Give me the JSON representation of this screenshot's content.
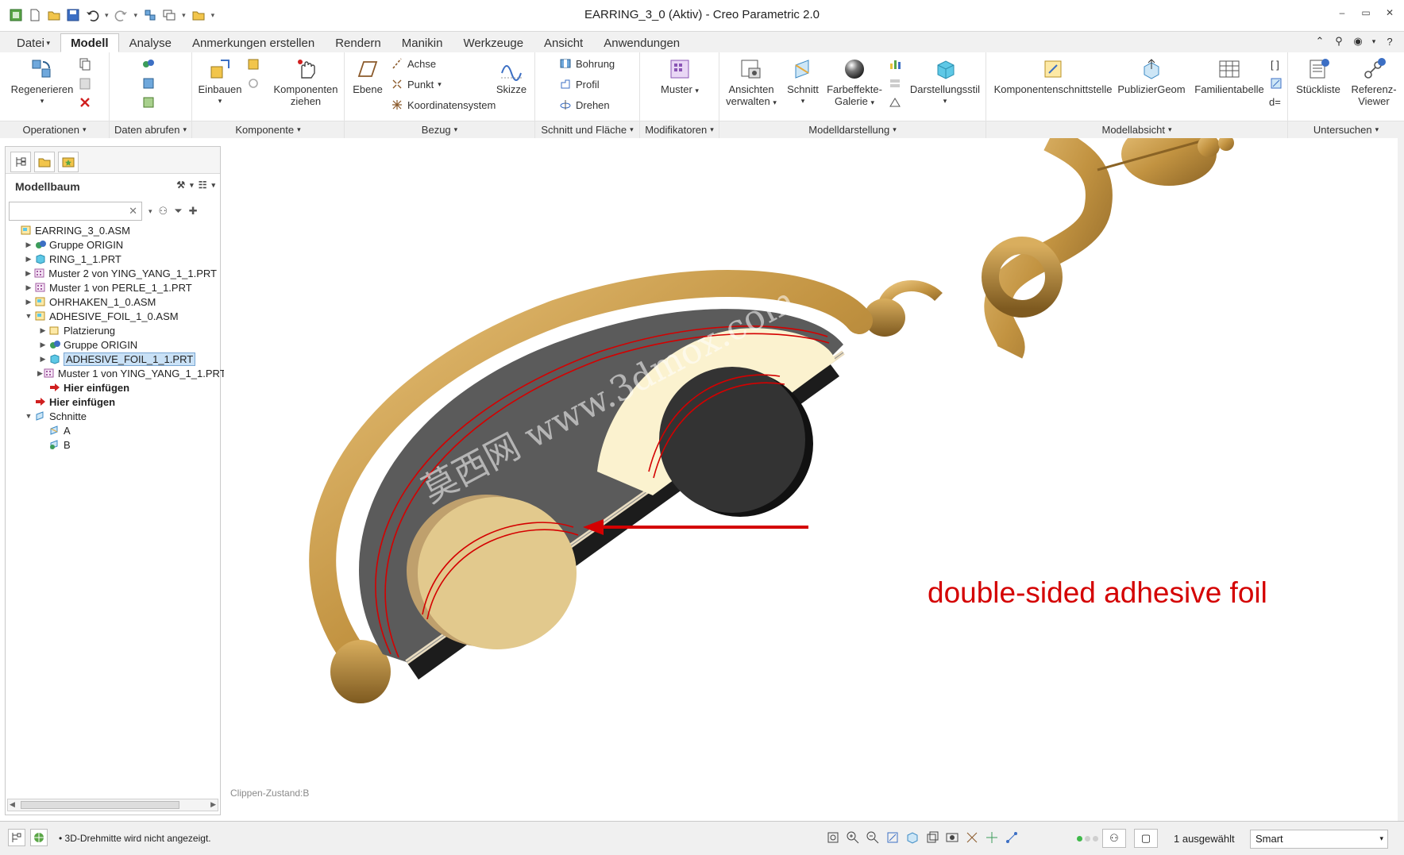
{
  "window": {
    "title": "EARRING_3_0 (Aktiv) - Creo Parametric 2.0"
  },
  "ribbon_tabs": [
    {
      "label": "Datei",
      "dropdown": "▾"
    },
    {
      "label": "Modell",
      "active": true
    },
    {
      "label": "Analyse"
    },
    {
      "label": "Anmerkungen erstellen"
    },
    {
      "label": "Rendern"
    },
    {
      "label": "Manikin"
    },
    {
      "label": "Werkzeuge"
    },
    {
      "label": "Ansicht"
    },
    {
      "label": "Anwendungen"
    }
  ],
  "ribbon": {
    "operationen": {
      "footer": "Operationen",
      "regenerieren": "Regenerieren"
    },
    "daten_abrufen": {
      "footer": "Daten abrufen"
    },
    "komponente": {
      "footer": "Komponente",
      "einbauen": "Einbauen",
      "komponenten_ziehen_1": "Komponenten",
      "komponenten_ziehen_2": "ziehen"
    },
    "bezug": {
      "footer": "Bezug",
      "ebene": "Ebene",
      "achse": "Achse",
      "punkt": "Punkt",
      "koordinatensystem": "Koordinatensystem",
      "skizze": "Skizze"
    },
    "schnitt_flaeche": {
      "footer": "Schnitt und Fläche",
      "bohrung": "Bohrung",
      "profil": "Profil",
      "drehen": "Drehen"
    },
    "modifikatoren": {
      "footer": "Modifikatoren",
      "muster": "Muster"
    },
    "modelldarstellung": {
      "footer": "Modelldarstellung",
      "ansichten_1": "Ansichten",
      "ansichten_2": "verwalten",
      "schnitt": "Schnitt",
      "farbeffekte_1": "Farbeffekte-",
      "farbeffekte_2": "Galerie",
      "darstellungsstil": "Darstellungsstil"
    },
    "modellabsicht": {
      "footer": "Modellabsicht",
      "komponentenschnittstelle": "Komponentenschnittstelle",
      "publiziergeom": "PublizierGeom",
      "familientabelle": "Familientabelle",
      "d_eq": "d="
    },
    "untersuchen": {
      "footer": "Untersuchen",
      "stueckliste": "Stückliste",
      "referenz_1": "Referenz-",
      "referenz_2": "Viewer"
    }
  },
  "left_panel": {
    "header": "Modellbaum",
    "search_value": "",
    "tree": [
      {
        "label": "EARRING_3_0.ASM",
        "level": 0,
        "toggle": "",
        "icon": "assembly"
      },
      {
        "label": "Gruppe ORIGIN",
        "level": 1,
        "toggle": "▶",
        "icon": "group"
      },
      {
        "label": "RING_1_1.PRT",
        "level": 1,
        "toggle": "▶",
        "icon": "part"
      },
      {
        "label": "Muster 2 von YING_YANG_1_1.PRT",
        "level": 1,
        "toggle": "▶",
        "icon": "pattern"
      },
      {
        "label": "Muster 1 von PERLE_1_1.PRT",
        "level": 1,
        "toggle": "▶",
        "icon": "pattern"
      },
      {
        "label": "OHRHAKEN_1_0.ASM",
        "level": 1,
        "toggle": "▶",
        "icon": "assembly"
      },
      {
        "label": "ADHESIVE_FOIL_1_0.ASM",
        "level": 1,
        "toggle": "▼",
        "icon": "assembly"
      },
      {
        "label": "Platzierung",
        "level": 2,
        "toggle": "▶",
        "icon": "placement"
      },
      {
        "label": "Gruppe ORIGIN",
        "level": 2,
        "toggle": "▶",
        "icon": "group"
      },
      {
        "label": "ADHESIVE_FOIL_1_1.PRT",
        "level": 2,
        "toggle": "▶",
        "icon": "part",
        "selected": true
      },
      {
        "label": "Muster 1 von YING_YANG_1_1.PRT",
        "level": 2,
        "toggle": "▶",
        "icon": "pattern"
      },
      {
        "label": "Hier einfügen",
        "level": 2,
        "toggle": "",
        "icon": "insert",
        "bold": true
      },
      {
        "label": "Hier einfügen",
        "level": 1,
        "toggle": "",
        "icon": "insert",
        "bold": true
      },
      {
        "label": "Schnitte",
        "level": 1,
        "toggle": "▼",
        "icon": "sections"
      },
      {
        "label": "A",
        "level": 2,
        "toggle": "",
        "icon": "section"
      },
      {
        "label": "B",
        "level": 2,
        "toggle": "",
        "icon": "section-active"
      }
    ]
  },
  "viewport": {
    "clip_state": "Clippen-Zustand:B",
    "annotation": "double-sided adhesive foil",
    "watermark": "莫西网 www.3dmox.com",
    "annotation_color": "#d40000",
    "gold_color": "#b8862f"
  },
  "status": {
    "message": "• 3D-Drehmitte wird nicht angezeigt.",
    "selection_count": "1 ausgewählt",
    "filter": "Smart"
  }
}
